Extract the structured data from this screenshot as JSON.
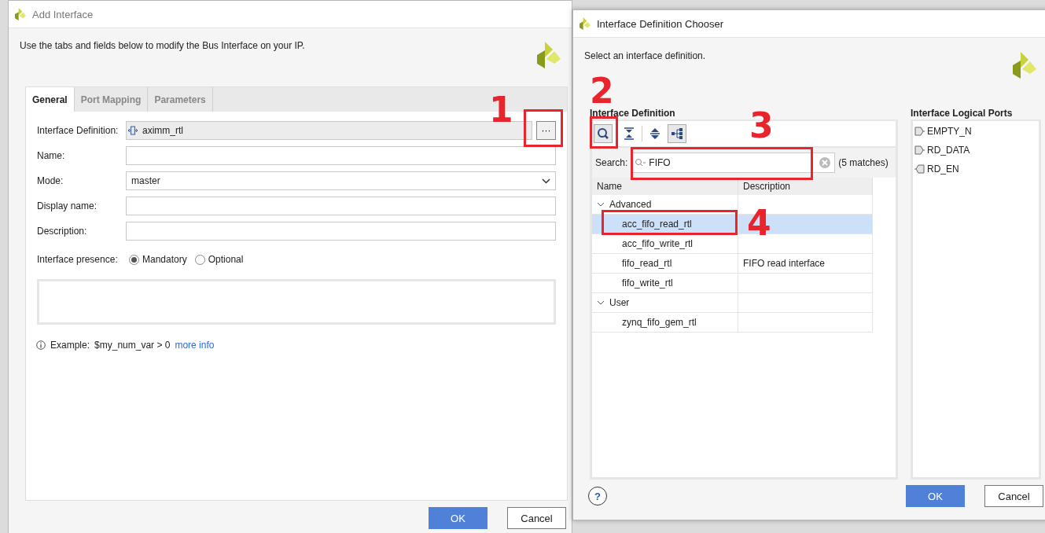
{
  "add_interface": {
    "title": "Add Interface",
    "instruction": "Use the tabs and fields below to modify the Bus Interface on your IP.",
    "tabs": [
      {
        "label": "General",
        "selected": true
      },
      {
        "label": "Port Mapping",
        "selected": false
      },
      {
        "label": "Parameters",
        "selected": false
      }
    ],
    "fields": [
      {
        "kind": "browse",
        "label": "Interface Definition:",
        "value": "aximm_rtl",
        "button": "···"
      },
      {
        "kind": "text",
        "label": "Name:"
      },
      {
        "kind": "select",
        "label": "Mode:",
        "value": "master"
      },
      {
        "kind": "text",
        "label": "Display name:"
      },
      {
        "kind": "text",
        "label": "Description:"
      }
    ],
    "presence": {
      "label": "Interface presence:",
      "options": [
        {
          "label": "Mandatory",
          "selected": true
        },
        {
          "label": "Optional",
          "selected": false
        }
      ]
    },
    "example": {
      "label": "Example:",
      "code": "$my_num_var > 0",
      "link": "more info"
    },
    "buttons": [
      "OK",
      "Cancel"
    ]
  },
  "chooser": {
    "title": "Interface Definition Chooser",
    "instruction": "Select an interface definition.",
    "section": "Interface Definition",
    "toolbar": [
      {
        "kind": "search",
        "pressed": true
      },
      {
        "kind": "collapse",
        "pressed": false
      },
      {
        "kind": "expand",
        "pressed": false
      },
      {
        "kind": "hierarchy",
        "pressed": true
      }
    ],
    "search": {
      "label": "Search:",
      "value": "FIFO",
      "matches": "(5 matches)"
    },
    "columns": [
      "Name",
      "Description"
    ],
    "tree": [
      {
        "name": "Advanced",
        "expanded": true,
        "children": [
          {
            "name": "acc_fifo_read_rtl",
            "selected": true
          },
          {
            "name": "acc_fifo_write_rtl",
            "selected": false
          },
          {
            "name": "fifo_read_rtl",
            "description": "FIFO read interface",
            "selected": false
          },
          {
            "name": "fifo_write_rtl",
            "selected": false
          }
        ]
      },
      {
        "name": "User",
        "expanded": true,
        "children": [
          {
            "name": "zynq_fifo_gem_rtl",
            "selected": false
          }
        ]
      }
    ],
    "ports_title": "Interface Logical Ports",
    "ports": [
      {
        "name": "EMPTY_N",
        "kind": "output"
      },
      {
        "name": "RD_DATA",
        "kind": "output"
      },
      {
        "name": "RD_EN",
        "kind": "input"
      }
    ],
    "help": "?",
    "buttons": [
      "OK",
      "Cancel"
    ]
  },
  "annotations": [
    {
      "number": "1"
    },
    {
      "number": "2"
    },
    {
      "number": "3"
    },
    {
      "number": "4"
    }
  ]
}
